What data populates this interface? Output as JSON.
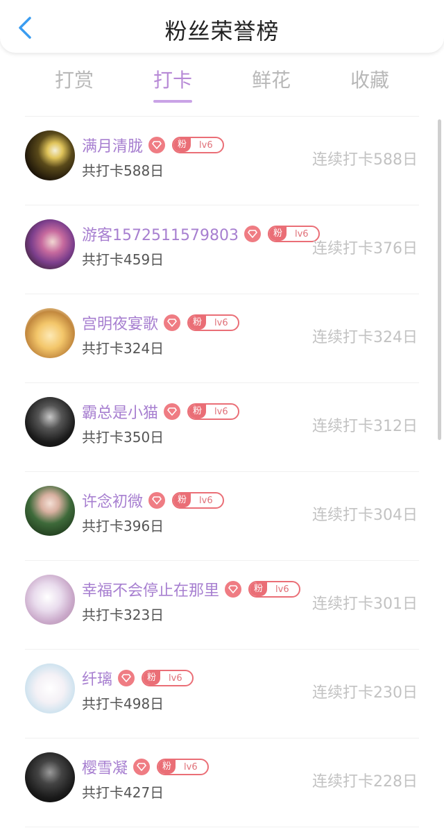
{
  "header": {
    "title": "粉丝荣誉榜",
    "back_icon": "chevron-left-icon"
  },
  "tabs": [
    {
      "label": "打赏",
      "active": false
    },
    {
      "label": "打卡",
      "active": true
    },
    {
      "label": "鲜花",
      "active": false
    },
    {
      "label": "收藏",
      "active": false
    }
  ],
  "colors": {
    "accent": "#b789d6",
    "badge": "#ea6e76",
    "back_icon": "#3a9cf0"
  },
  "badge": {
    "fan_label": "粉",
    "level": "lv6",
    "gem_icon": "diamond-icon"
  },
  "fans": [
    {
      "name": "满月清胧",
      "total": "共打卡588日",
      "streak": "连续打卡588日"
    },
    {
      "name": "游客1572511579803",
      "total": "共打卡459日",
      "streak": "连续打卡376日"
    },
    {
      "name": "宫明夜宴歌",
      "total": "共打卡324日",
      "streak": "连续打卡324日"
    },
    {
      "name": "霸总是小猫",
      "total": "共打卡350日",
      "streak": "连续打卡312日"
    },
    {
      "name": "许念初微",
      "total": "共打卡396日",
      "streak": "连续打卡304日"
    },
    {
      "name": "幸福不会停止在那里",
      "total": "共打卡323日",
      "streak": "连续打卡301日"
    },
    {
      "name": "纤璃",
      "total": "共打卡498日",
      "streak": "连续打卡230日"
    },
    {
      "name": "樱雪凝",
      "total": "共打卡427日",
      "streak": "连续打卡228日"
    }
  ]
}
